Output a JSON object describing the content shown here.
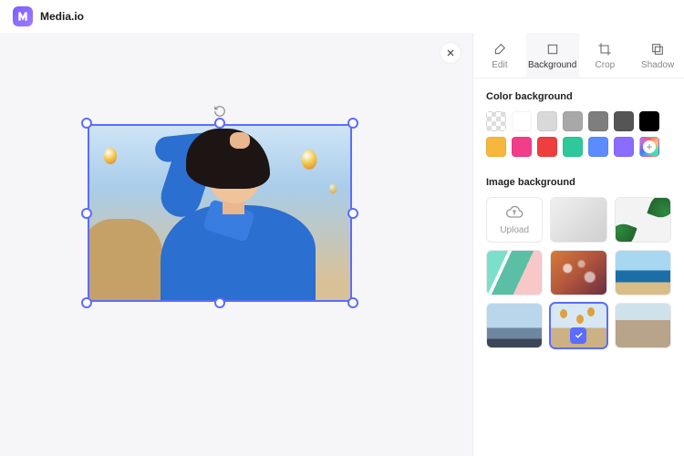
{
  "brand": "Media.io",
  "tabs": [
    {
      "id": "edit",
      "label": "Edit"
    },
    {
      "id": "background",
      "label": "Background"
    },
    {
      "id": "crop",
      "label": "Crop"
    },
    {
      "id": "shadow",
      "label": "Shadow"
    }
  ],
  "active_tab": "background",
  "sections": {
    "color_title": "Color background",
    "image_title": "Image background",
    "upload_label": "Upload"
  },
  "color_swatches": [
    "transparent",
    "#ffffff",
    "#d9d9d9",
    "#a8a8a8",
    "#7e7e7e",
    "#555555",
    "#000000",
    "#f6b73c",
    "#f23d8a",
    "#ef3e3e",
    "#2fc89a",
    "#5b8cff",
    "#8a6cff",
    "add"
  ],
  "image_backgrounds": [
    {
      "id": "upload",
      "type": "upload"
    },
    {
      "id": "grey",
      "cls": "bg-gradient-grey"
    },
    {
      "id": "leaf",
      "cls": "bg-leaf"
    },
    {
      "id": "stripes",
      "cls": "bg-stripes"
    },
    {
      "id": "bokeh",
      "cls": "bg-bokeh"
    },
    {
      "id": "sea",
      "cls": "bg-sea"
    },
    {
      "id": "mtn",
      "cls": "bg-mtn"
    },
    {
      "id": "balloons",
      "cls": "bg-balloons",
      "selected": true
    },
    {
      "id": "street",
      "cls": "bg-street"
    }
  ]
}
